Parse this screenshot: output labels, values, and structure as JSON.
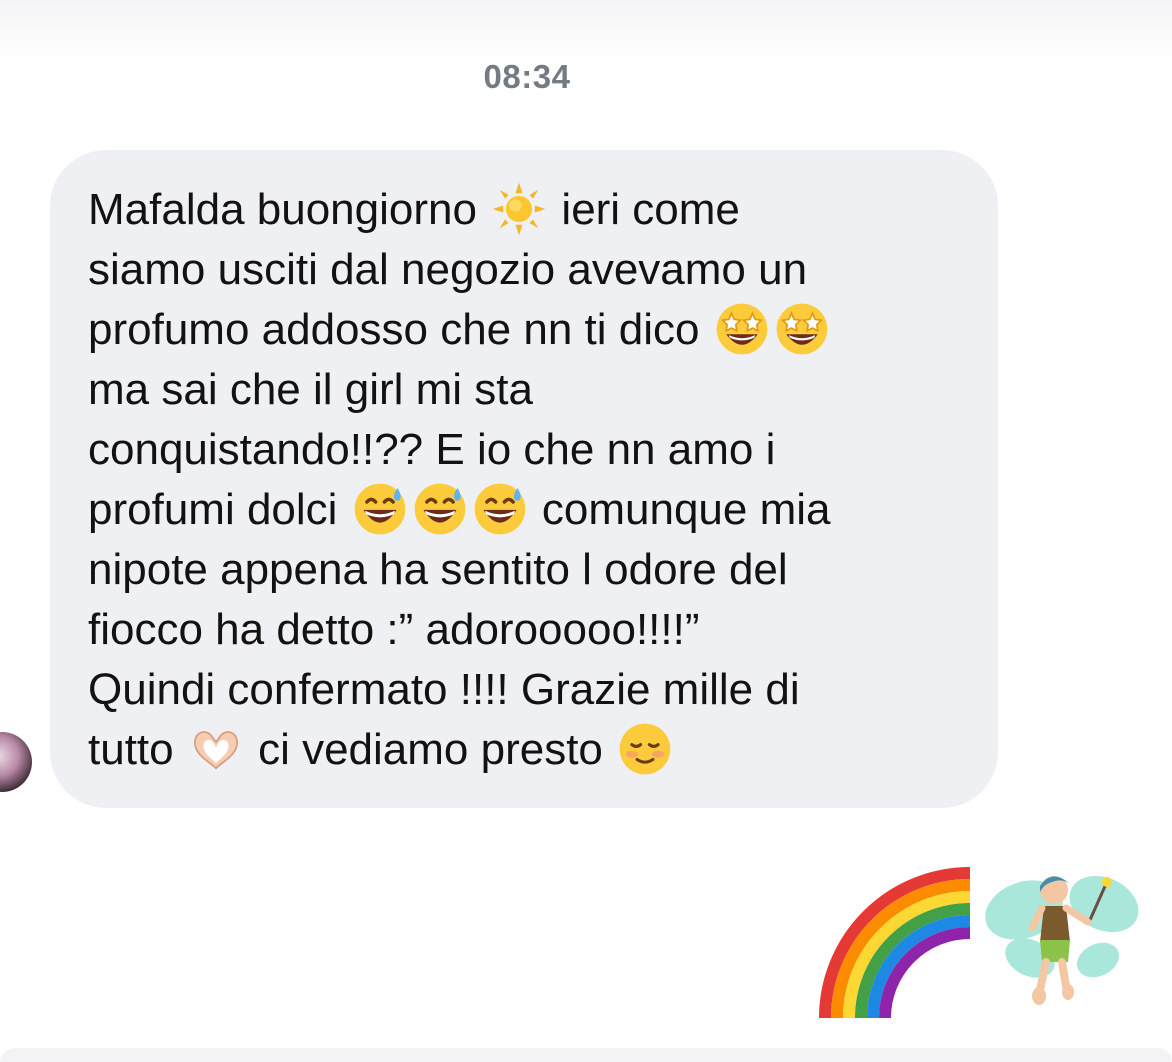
{
  "conversation": {
    "timestamp": "08:34",
    "message": {
      "sender_avatar_icon": "contact-avatar",
      "lines": [
        {
          "segments": [
            "Mafalda buongiorno ",
            "sun-icon",
            " ieri come"
          ]
        },
        {
          "segments": [
            "siamo usciti dal negozio avevamo un"
          ]
        },
        {
          "segments": [
            "profumo addosso che nn ti dico ",
            "star-struck-icon",
            "star-struck-icon"
          ]
        },
        {
          "segments": [
            "ma sai che il girl mi sta"
          ]
        },
        {
          "segments": [
            "conquistando!!?? E io che nn amo i"
          ]
        },
        {
          "segments": [
            "profumi dolci ",
            "grinning-sweat-icon",
            "grinning-sweat-icon",
            "grinning-sweat-icon",
            " comunque mia"
          ]
        },
        {
          "segments": [
            "nipote appena ha sentito l odore del"
          ]
        },
        {
          "segments": [
            "fiocco ha detto :” adorooooo!!!!”"
          ]
        },
        {
          "segments": [
            "Quindi confermato !!!! Grazie mille di"
          ]
        },
        {
          "segments": [
            "tutto ",
            "heart-hands-icon",
            " ci vediamo presto ",
            "smiling-face-icon"
          ]
        }
      ]
    },
    "reaction": {
      "emojis": [
        "rainbow-icon",
        "fairy-icon"
      ]
    }
  },
  "colors": {
    "bubble_background": "#eff0f4",
    "message_text": "#121212",
    "timestamp_text": "#757b83",
    "page_background": "#ffffff"
  }
}
